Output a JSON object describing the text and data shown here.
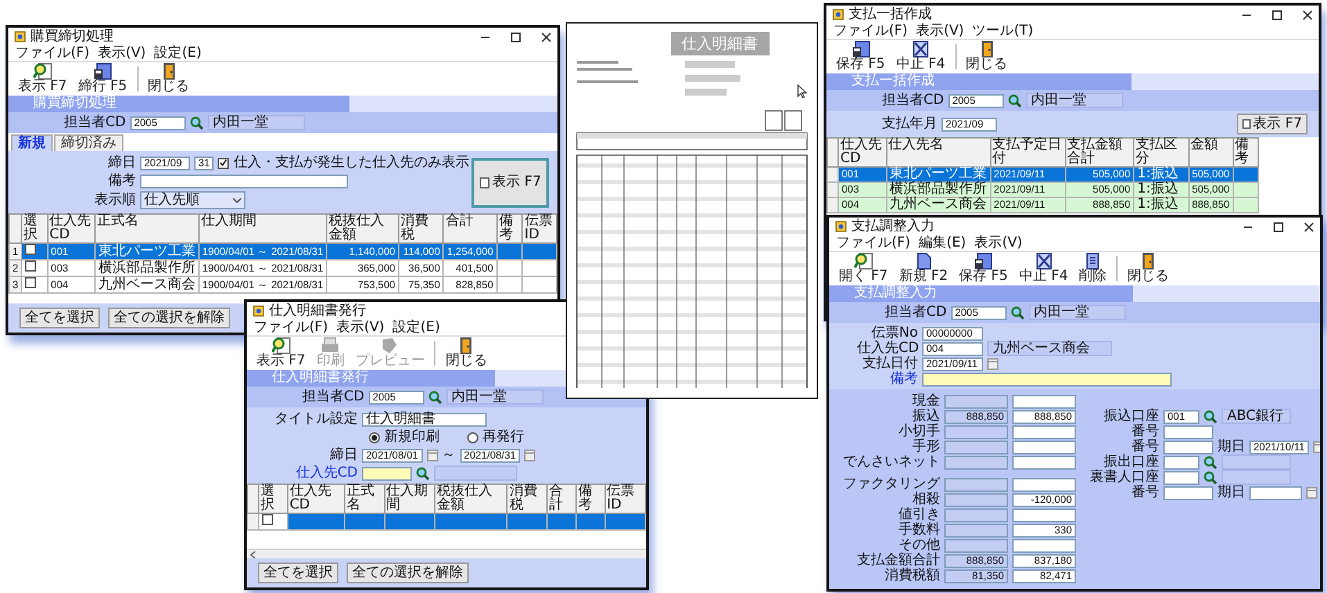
{
  "closing_window": {
    "title": "購買締切処理",
    "menu": [
      "ファイル(F)",
      "表示(V)",
      "設定(E)"
    ],
    "tools": [
      {
        "kind": "view",
        "label": "表示 F7",
        "disabled": false
      },
      {
        "kind": "save",
        "label": "締行 F5",
        "disabled": false
      },
      {
        "kind": "close",
        "label": "閉じる",
        "disabled": false
      }
    ],
    "heading": "購買締切処理",
    "staff": {
      "label": "担当者CD",
      "value": "2005",
      "name": "内田一堂"
    },
    "tabs": [
      {
        "label": "新規",
        "selected": true
      },
      {
        "label": "締切済み",
        "selected": false
      }
    ],
    "cutoff": {
      "label": "締日",
      "month": "2021/09",
      "day": "31"
    },
    "filter": {
      "label": "仕入・支払が発生した仕入先のみ表示",
      "checked": true
    },
    "memo": {
      "label": "備考"
    },
    "order": {
      "label": "表示順",
      "value": "仕入先順"
    },
    "show_button": "表示 F7",
    "columns": [
      "選択",
      "仕入先CD",
      "正式名",
      "仕入期間",
      "税抜仕入金額",
      "消費税",
      "合計",
      "備考",
      "伝票ID"
    ],
    "rows": [
      {
        "number": "1",
        "checked": false,
        "selected": true,
        "code": "001",
        "name": "東北パーツ工業",
        "period": "1900/04/01 ～ 2021/08/31",
        "amount": "1,140,000",
        "tax": "114,000",
        "total": "1,254,000"
      },
      {
        "number": "2",
        "checked": false,
        "selected": false,
        "code": "003",
        "name": "横浜部品製作所",
        "period": "1900/04/01 ～ 2021/08/31",
        "amount": "365,000",
        "tax": "36,500",
        "total": "401,500"
      },
      {
        "number": "3",
        "checked": false,
        "selected": false,
        "code": "004",
        "name": "九州ベース商会",
        "period": "1900/04/01 ～ 2021/08/31",
        "amount": "753,500",
        "tax": "75,350",
        "total": "828,850"
      }
    ],
    "buttons": [
      "全てを選択",
      "全ての選択を解除"
    ]
  },
  "issue_window": {
    "title": "仕入明細書発行",
    "menu": [
      "ファイル(F)",
      "表示(V)",
      "設定(E)"
    ],
    "tools": [
      {
        "kind": "view",
        "label": "表示 F7",
        "disabled": false
      },
      {
        "kind": "print",
        "label": "印刷",
        "disabled": true
      },
      {
        "kind": "preview",
        "label": "プレビュー",
        "disabled": true
      },
      {
        "kind": "close",
        "label": "閉じる",
        "disabled": false
      }
    ],
    "heading": "仕入明細書発行",
    "staff": {
      "label": "担当者CD",
      "value": "2005",
      "name": "内田一堂"
    },
    "title_setting": {
      "label": "タイトル設定",
      "value": "仕入明細書"
    },
    "modes": [
      {
        "label": "新規印刷",
        "selected": true
      },
      {
        "label": "再発行",
        "selected": false
      }
    ],
    "period": {
      "label": "締日",
      "from": "2021/08/01",
      "separator": "～",
      "to": "2021/08/31"
    },
    "vendor": {
      "label": "仕入先CD",
      "focused": true
    },
    "columns": [
      "選択",
      "仕入先CD",
      "正式名",
      "仕入期間",
      "税抜仕入金額",
      "消費税",
      "合計",
      "備考",
      "伝票ID"
    ],
    "rows": [
      {
        "checked": false,
        "selected": true
      }
    ],
    "buttons": [
      "全てを選択",
      "全ての選択を解除"
    ]
  },
  "statement_document": {
    "title": "仕入明細書"
  },
  "batch_window": {
    "title": "支払一括作成",
    "menu": [
      "ファイル(F)",
      "表示(V)",
      "ツール(T)"
    ],
    "tools": [
      {
        "kind": "save",
        "label": "保存 F5",
        "disabled": false
      },
      {
        "kind": "cancel",
        "label": "中止 F4",
        "disabled": false
      },
      {
        "kind": "close",
        "label": "閉じる",
        "disabled": false
      }
    ],
    "heading": "支払一括作成",
    "staff": {
      "label": "担当者CD",
      "value": "2005",
      "name": "内田一堂"
    },
    "month": {
      "label": "支払年月",
      "value": "2021/09"
    },
    "show_button": "表示 F7",
    "columns": [
      "仕入先CD",
      "仕入先名",
      "支払予定日付",
      "支払金額合計",
      "支払区分",
      "金額",
      "備考"
    ],
    "rows": [
      {
        "selected": true,
        "code": "001",
        "name": "東北パーツ工業",
        "date": "2021/09/11",
        "sum": "505,000",
        "method": "1:振込",
        "amount": "505,000"
      },
      {
        "selected": false,
        "code": "003",
        "name": "横浜部品製作所",
        "date": "2021/09/11",
        "sum": "505,000",
        "method": "1:振込",
        "amount": "505,000"
      },
      {
        "selected": false,
        "code": "004",
        "name": "九州ベース商会",
        "date": "2021/09/11",
        "sum": "888,850",
        "method": "1:振込",
        "amount": "888,850"
      }
    ]
  },
  "adjust_window": {
    "title": "支払調整入力",
    "menu": [
      "ファイル(F)",
      "編集(E)",
      "表示(V)"
    ],
    "tools": [
      {
        "kind": "view",
        "label": "開く F7",
        "disabled": false
      },
      {
        "kind": "new",
        "label": "新規 F2",
        "disabled": false
      },
      {
        "kind": "save",
        "label": "保存 F5",
        "disabled": false
      },
      {
        "kind": "cancel",
        "label": "中止 F4",
        "disabled": false
      },
      {
        "kind": "delete",
        "label": "削除",
        "disabled": false
      },
      {
        "kind": "close",
        "label": "閉じる",
        "disabled": false
      }
    ],
    "heading": "支払調整入力",
    "staff": {
      "label": "担当者CD",
      "value": "2005",
      "name": "内田一堂"
    },
    "fields": [
      {
        "kind": "text",
        "label": "伝票No",
        "value": "00000000"
      },
      {
        "kind": "vendor",
        "label": "仕入先CD",
        "value": "004",
        "name": "九州ベース商会"
      },
      {
        "kind": "date",
        "label": "支払日付",
        "value": "2021/09/11"
      },
      {
        "kind": "memo",
        "label": "備考",
        "focused": true
      }
    ],
    "amounts": [
      {
        "label": "現金"
      },
      {
        "label": "振込",
        "planned": "888,850",
        "actual": "888,850"
      },
      {
        "label": "小切手"
      },
      {
        "label": "手形"
      },
      {
        "label": "でんさいネット"
      }
    ],
    "adjustments": [
      {
        "label": "ファクタリング"
      },
      {
        "label": "相殺",
        "actual": "-120,000"
      },
      {
        "label": "値引き"
      },
      {
        "label": "手数料",
        "actual": "330"
      },
      {
        "label": "その他"
      },
      {
        "label": "支払金額合計",
        "planned": "888,850",
        "actual": "837,180"
      },
      {
        "label": "消費税額",
        "planned": "81,350",
        "actual": "82,471"
      }
    ],
    "accounts": [
      {
        "kind": "account",
        "label": "振込口座",
        "value": "001",
        "name": "ABC銀行"
      },
      {
        "kind": "number",
        "label": "番号"
      },
      {
        "kind": "due",
        "label": "番号",
        "date_label": "期日",
        "date": "2021/10/11"
      },
      {
        "kind": "account",
        "label": "振出口座"
      },
      {
        "kind": "account",
        "label": "裏書人口座"
      },
      {
        "kind": "due",
        "label": "番号",
        "date_label": "期日"
      }
    ]
  }
}
